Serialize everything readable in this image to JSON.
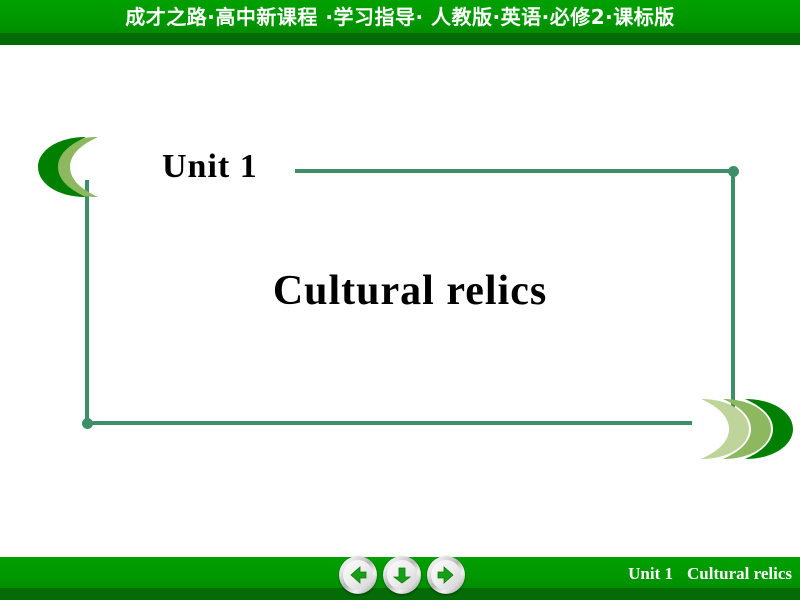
{
  "header": {
    "title": "成才之路·高中新课程 ·学习指导· 人教版·英语·必修2·课标版"
  },
  "slide": {
    "unit_label": "Unit 1",
    "main_title": "Cultural relics"
  },
  "footer": {
    "unit_label": "Unit 1",
    "title_label": "Cultural relics",
    "nav": {
      "prev_label": "Previous slide",
      "down_label": "Next step",
      "next_label": "Next slide"
    }
  },
  "colors": {
    "band_green": "#009800",
    "band_shadow_green": "#046b06",
    "frame_line": "#3d8f67",
    "chevron_dark": "#008000",
    "chevron_mid": "#8db860",
    "chevron_light": "#bed49a",
    "title_black": "#000000",
    "band_text": "#ffffff"
  }
}
